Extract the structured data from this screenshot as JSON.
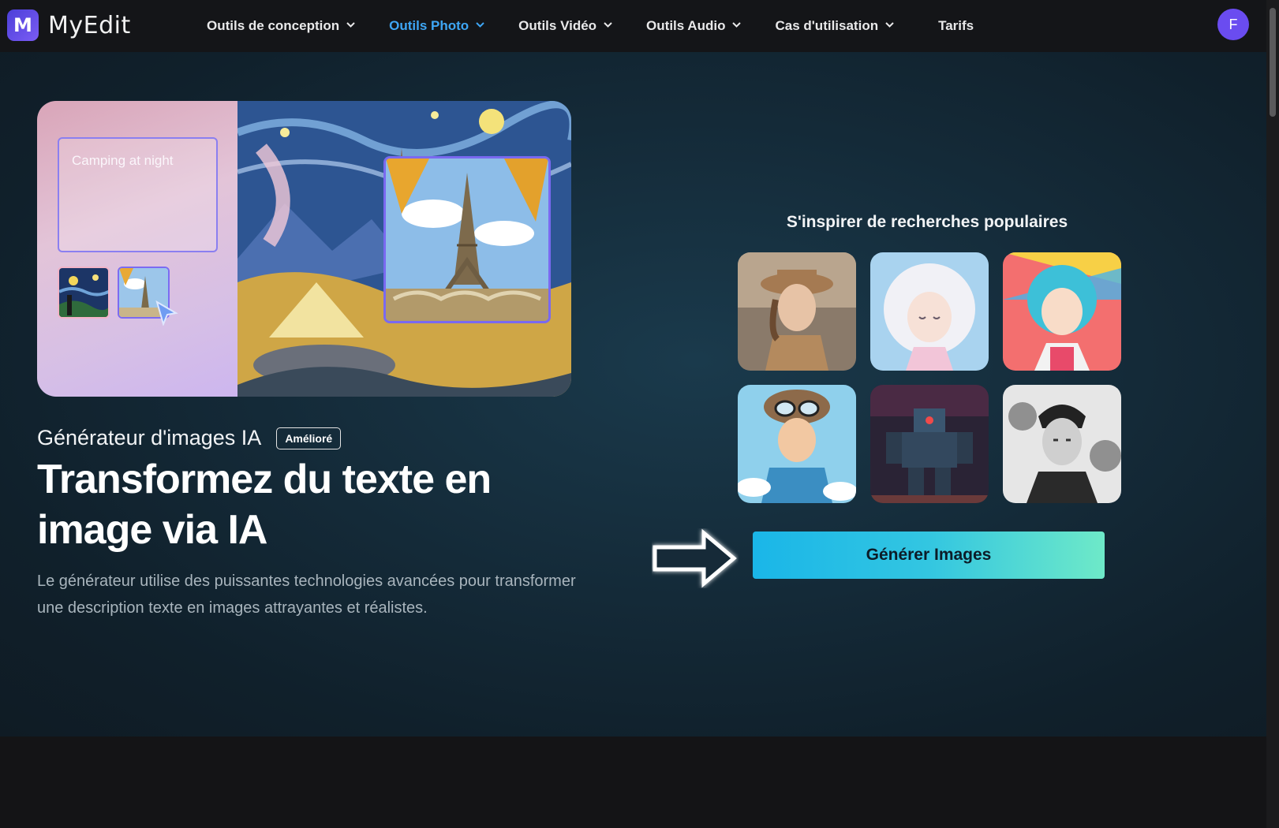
{
  "brand": {
    "logo_letter": "M",
    "name": "MyEdit"
  },
  "nav": {
    "items": [
      {
        "label": "Outils de conception",
        "dropdown": true,
        "active": false
      },
      {
        "label": "Outils Photo",
        "dropdown": true,
        "active": true
      },
      {
        "label": "Outils Vidéo",
        "dropdown": true,
        "active": false
      },
      {
        "label": "Outils Audio",
        "dropdown": true,
        "active": false
      },
      {
        "label": "Cas d'utilisation",
        "dropdown": true,
        "active": false
      },
      {
        "label": "Tarifs",
        "dropdown": false,
        "active": false
      }
    ],
    "avatar_initial": "F"
  },
  "showcase": {
    "prompt_text": "Camping at night",
    "thumbnails": [
      "starry-night-thumbnail",
      "eiffel-tower-thumbnail"
    ]
  },
  "hero": {
    "subtitle": "Générateur d'images IA",
    "badge": "Amélioré",
    "headline": "Transformez du texte en image via IA",
    "description": "Le générateur utilise des puissantes technologies avancées pour transformer une description texte en images attrayantes et réalistes."
  },
  "inspire": {
    "title": "S'inspirer de recherches populaires",
    "images": [
      "woman-in-hat-portrait",
      "white-haired-anime-girl",
      "colorful-anime-girl",
      "pop-art-pilot-woman",
      "mech-robot",
      "ink-sketch-man-portrait"
    ]
  },
  "cta": {
    "label": "Générer Images"
  },
  "colors": {
    "accent_active": "#3ea6f5",
    "avatar": "#6a4cf0",
    "cta_start": "#1ab6e8",
    "cta_end": "#6ee9c8",
    "frame_purple": "#7a69f0"
  }
}
